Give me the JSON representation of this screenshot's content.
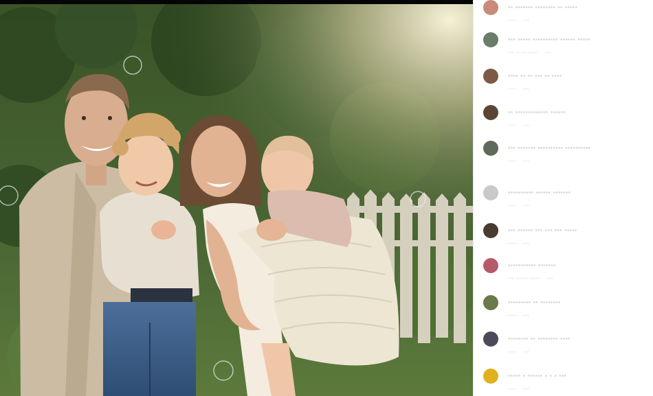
{
  "post": {
    "image_alt": "Family photo outdoors: man in beige suit holding a curly-haired toddler, woman holding a baby wrapped in a cream knit blanket, in a garden with a white picket fence"
  },
  "comments": [
    {
      "text": "·· ······· ········ ·· ·····",
      "time": "····",
      "likes": "···"
    },
    {
      "text": "··· ·····  ·········· ······ ·····",
      "time": "··· ·· ·· ·····",
      "likes": "···"
    },
    {
      "text": "···· ·· ·· ··· ·· ····",
      "time": "····",
      "likes": "···"
    },
    {
      "text": "·· ············· ······",
      "time": "····",
      "likes": "···"
    },
    {
      "text": "··· ······· ·········· ··········",
      "time": "····",
      "likes": "···"
    },
    {
      "text": "·········· ······ ·······",
      "time": "····",
      "likes": "···"
    },
    {
      "text": "··· ······ ··· ··· ··· ·····",
      "time": "····",
      "likes": "···"
    },
    {
      "text": "··········· ·······",
      "time": "··· ······ ·····",
      "likes": "···"
    },
    {
      "text": "········· ·· ········",
      "time": "····",
      "likes": "···"
    },
    {
      "text": "········ ·· ········ ····",
      "time": "····",
      "likes": "···"
    },
    {
      "text": "····· · ······ · · · ···",
      "time": "····",
      "likes": "···"
    }
  ],
  "colors": {
    "foliage": "#3f5a2c",
    "fence": "#ddd6c6",
    "suit": "#cbbca3",
    "blanket": "#ede6d3",
    "text": "#262626",
    "meta": "#a8a8a8"
  }
}
